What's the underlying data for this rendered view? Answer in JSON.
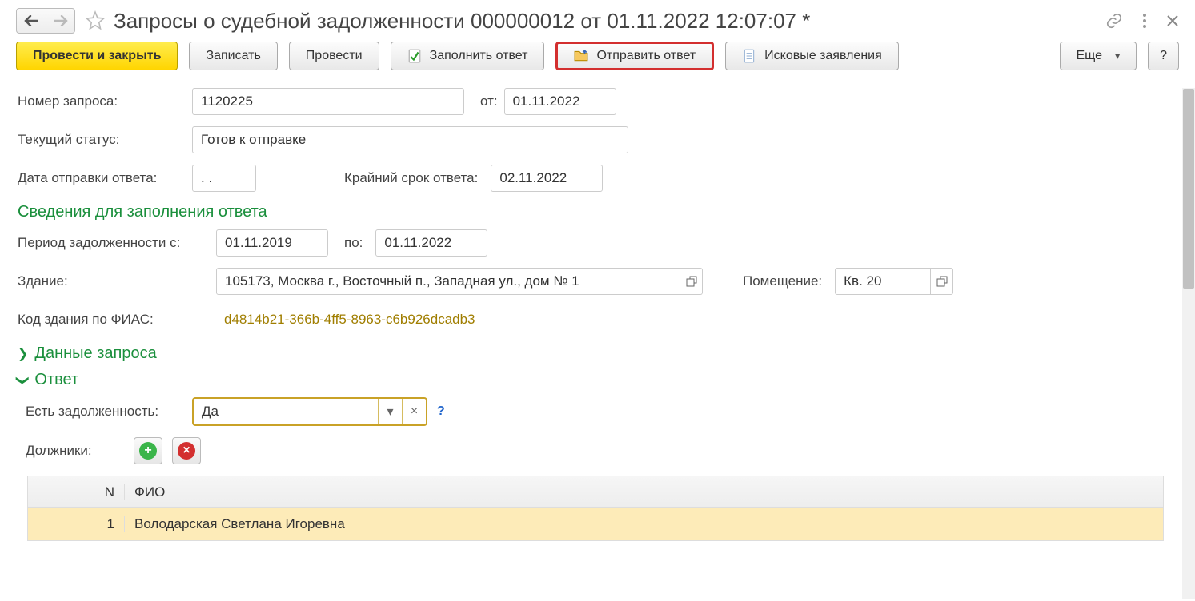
{
  "header": {
    "title": "Запросы о судебной задолженности 000000012 от 01.11.2022 12:07:07 *"
  },
  "toolbar": {
    "post_close": "Провести и закрыть",
    "save": "Записать",
    "post": "Провести",
    "fill_response": "Заполнить ответ",
    "send_response": "Отправить ответ",
    "claims": "Исковые заявления",
    "more": "Еще",
    "help": "?"
  },
  "form": {
    "request_number_label": "Номер запроса:",
    "request_number": "1120225",
    "from_label": "от:",
    "from_date": "01.11.2022",
    "status_label": "Текущий статус:",
    "status": "Готов к отправке",
    "sent_date_label": "Дата отправки ответа:",
    "sent_date": "  .  .",
    "deadline_label": "Крайний срок ответа:",
    "deadline": "02.11.2022",
    "section_response_info": "Сведения для заполнения ответа",
    "debt_period_from_label": "Период задолженности с:",
    "debt_period_from": "01.11.2019",
    "debt_period_to_label": "по:",
    "debt_period_to": "01.11.2022",
    "building_label": "Здание:",
    "building": "105173, Москва г., Восточный п., Западная ул., дом № 1",
    "premises_label": "Помещение:",
    "premises": "Кв. 20",
    "fias_label": "Код здания по ФИАС:",
    "fias_code": "d4814b21-366b-4ff5-8963-c6b926dcadb3",
    "section_request_data": "Данные запроса",
    "section_response": "Ответ",
    "has_debt_label": "Есть задолженность:",
    "has_debt_value": "Да",
    "debtors_label": "Должники:"
  },
  "table": {
    "headers": {
      "n": "N",
      "fio": "ФИО"
    },
    "rows": [
      {
        "n": "1",
        "fio": "Володарская Светлана Игоревна"
      }
    ]
  }
}
